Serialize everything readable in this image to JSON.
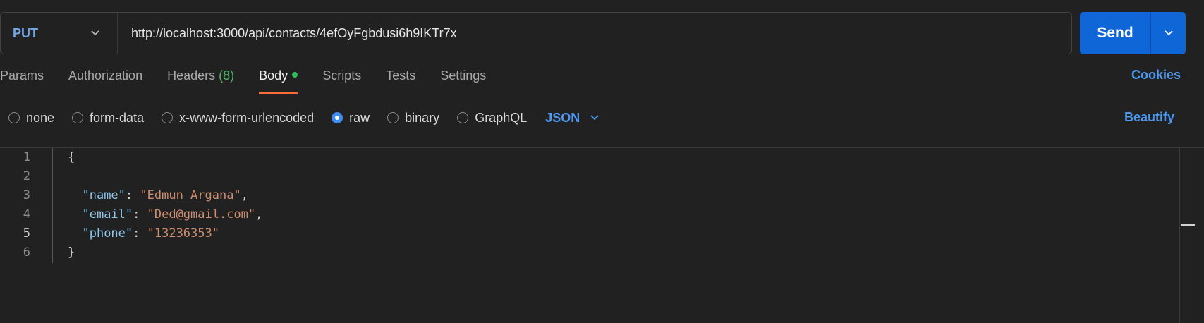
{
  "request": {
    "method": "PUT",
    "url": "http://localhost:3000/api/contacts/4efOyFgbdusi6h9IKTr7x",
    "send_label": "Send"
  },
  "tabs": [
    {
      "label": "Params",
      "active": false
    },
    {
      "label": "Authorization",
      "active": false
    },
    {
      "label": "Headers",
      "count": "(8)",
      "active": false
    },
    {
      "label": "Body",
      "active": true
    },
    {
      "label": "Scripts",
      "active": false
    },
    {
      "label": "Tests",
      "active": false
    },
    {
      "label": "Settings",
      "active": false
    }
  ],
  "cookies_label": "Cookies",
  "body_types": [
    {
      "label": "none",
      "selected": false
    },
    {
      "label": "form-data",
      "selected": false
    },
    {
      "label": "x-www-form-urlencoded",
      "selected": false
    },
    {
      "label": "raw",
      "selected": true
    },
    {
      "label": "binary",
      "selected": false
    },
    {
      "label": "GraphQL",
      "selected": false
    }
  ],
  "format": "JSON",
  "beautify_label": "Beautify",
  "editor": {
    "line_numbers": [
      "1",
      "2",
      "3",
      "4",
      "5",
      "6"
    ],
    "current_line": "5",
    "open_brace": "{",
    "close_brace": "}",
    "fields": [
      {
        "key": "\"name\"",
        "value": "\"Edmun Argana\"",
        "trailing": ","
      },
      {
        "key": "\"email\"",
        "value": "\"Ded@gmail.com\"",
        "trailing": ","
      },
      {
        "key": "\"phone\"",
        "value": "\"13236353\"",
        "trailing": ""
      }
    ]
  },
  "colors": {
    "accent_blue": "#0f66d6",
    "link_blue": "#4d97ee",
    "active_tab_underline": "#ff6c37",
    "body_dot": "#2fbb5a",
    "json_key": "#8bc8f0",
    "json_string": "#ce8d6e"
  }
}
